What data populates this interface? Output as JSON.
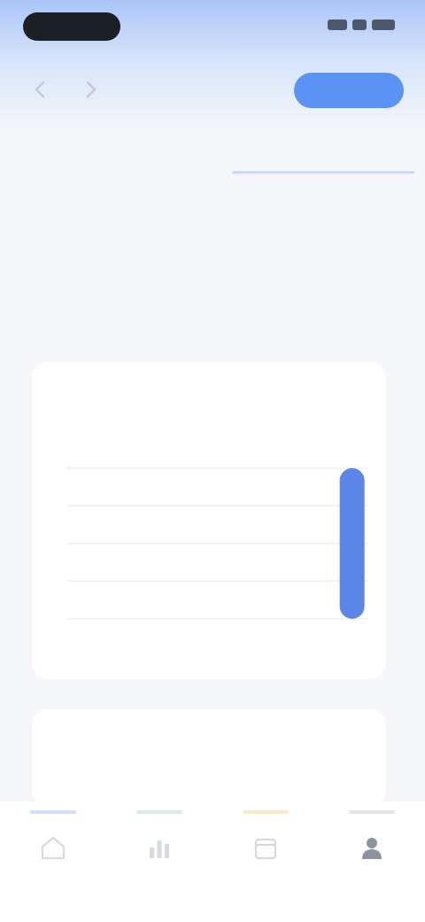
{
  "status_bar": {
    "time": "",
    "icons": [
      "signal-icon",
      "wifi-icon",
      "battery-icon"
    ]
  },
  "header": {
    "back_icon": "chevron-left-icon",
    "forward_icon": "chevron-right-icon",
    "primary_button_label": ""
  },
  "tabs": [
    {
      "label": "",
      "active": false
    },
    {
      "label": "",
      "active": true
    }
  ],
  "section_label": "",
  "stats": [
    {
      "value": "",
      "caption": ""
    },
    {
      "value": "",
      "caption": ""
    },
    {
      "value": "",
      "caption": ""
    }
  ],
  "metric_card": {
    "title": "",
    "subtitle": ""
  },
  "chart_data": {
    "type": "bar",
    "categories": [
      "",
      "",
      "",
      "",
      "",
      ""
    ],
    "values": [
      0,
      0,
      0,
      0,
      0,
      100
    ],
    "ylim": [
      0,
      100
    ],
    "grid": true,
    "highlight_color": "#5b86e8"
  },
  "second_card": {
    "title": ""
  },
  "bottom_nav": [
    {
      "icon": "home-icon",
      "label": "",
      "accent": "#cfe0fb",
      "active": false
    },
    {
      "icon": "chart-icon",
      "label": "",
      "accent": "#d6efe0",
      "active": false
    },
    {
      "icon": "calendar-icon",
      "label": "",
      "accent": "#fbe9c6",
      "active": false
    },
    {
      "icon": "profile-icon",
      "label": "",
      "accent": "#e2e4ea",
      "active": true
    }
  ],
  "colors": {
    "accent": "#5b93f5",
    "bar": "#5b86e8",
    "header_gradient_top": "#a9c5f7"
  }
}
